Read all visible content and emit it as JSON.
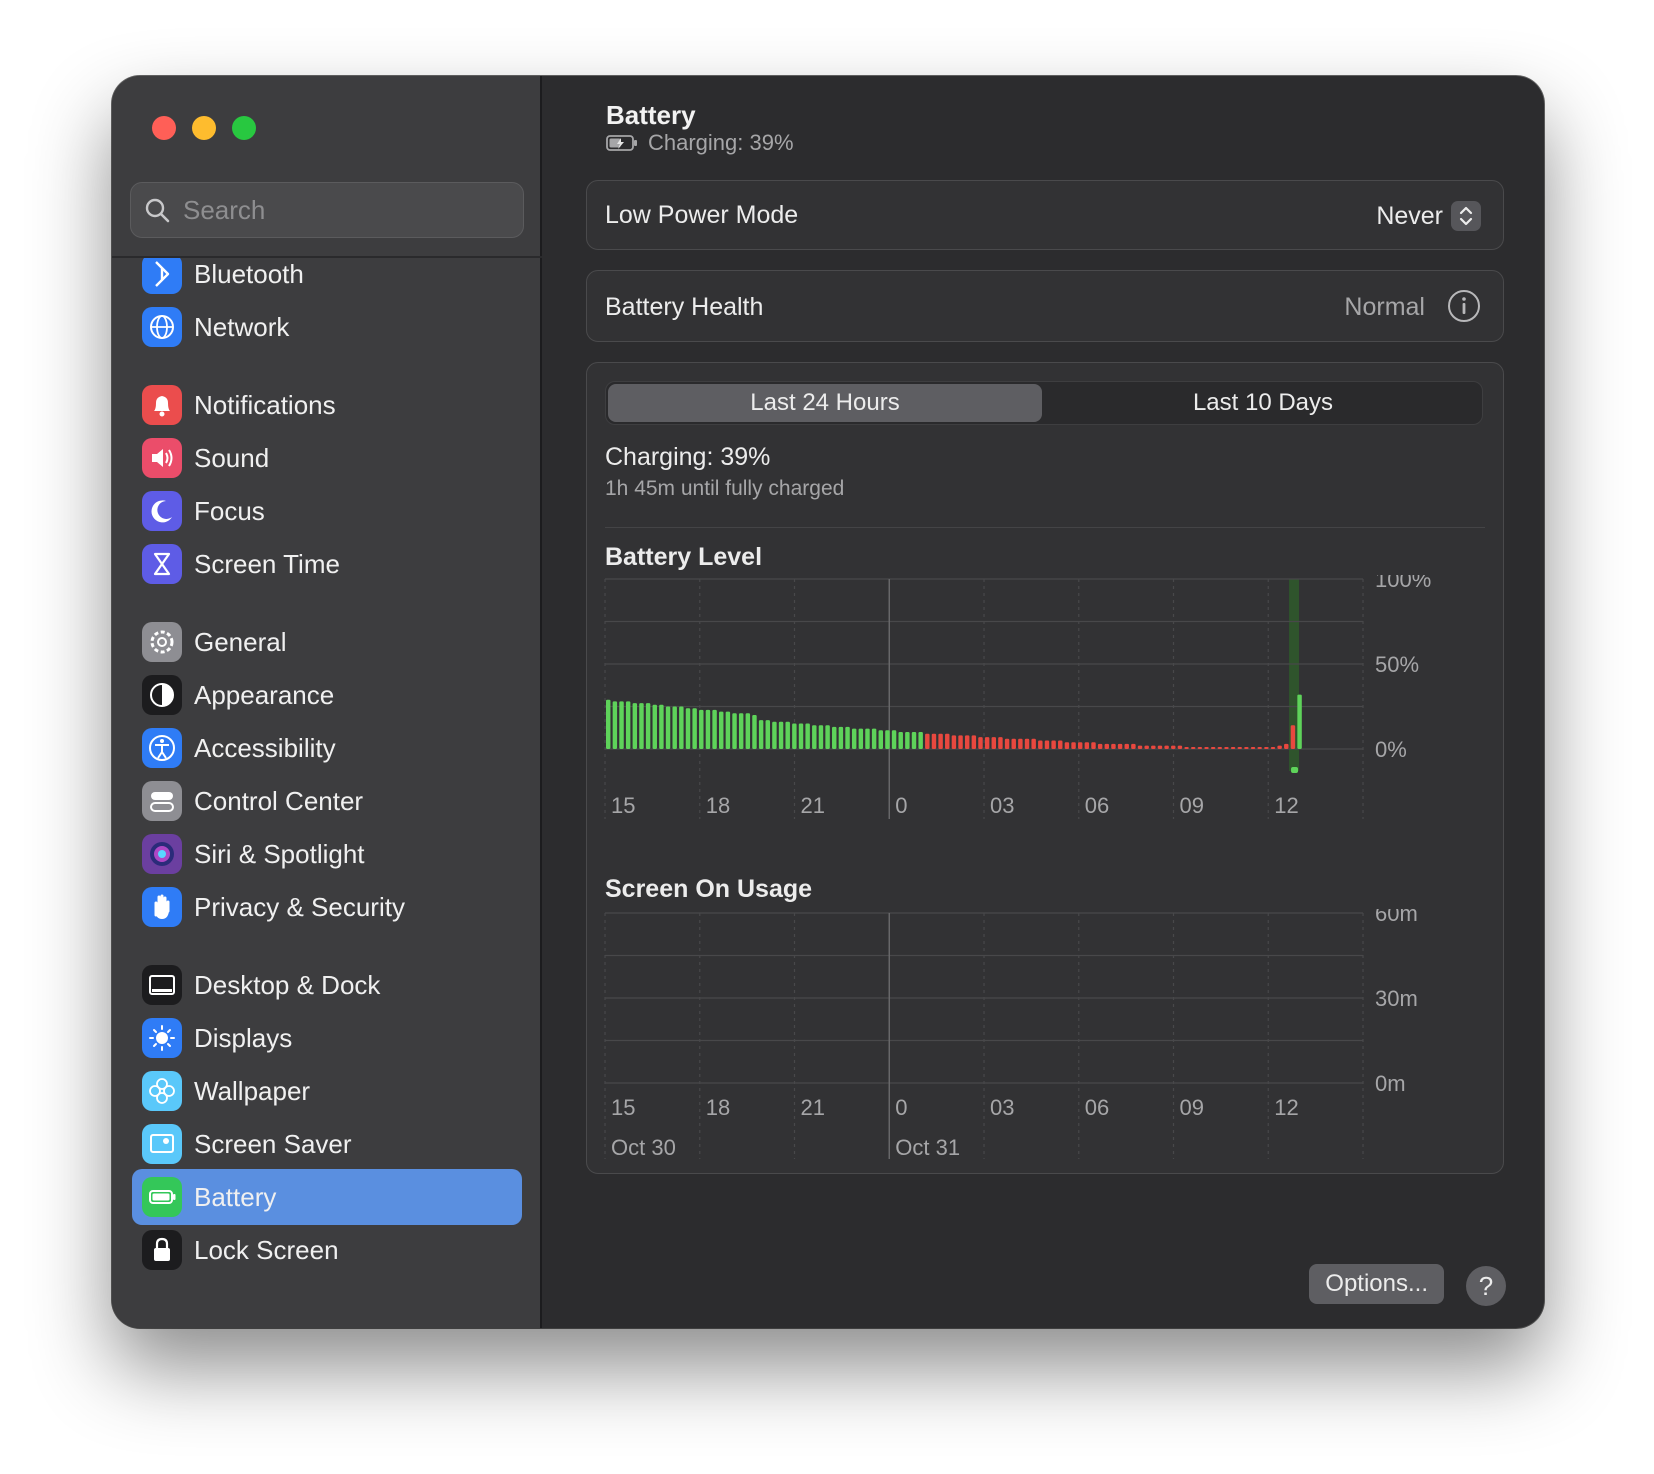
{
  "window": {
    "search_placeholder": "Search"
  },
  "sidebar": {
    "items": [
      {
        "label": "Bluetooth",
        "icon": "bluetooth-icon",
        "color": "#2f7cf6"
      },
      {
        "label": "Network",
        "icon": "globe-icon",
        "color": "#2f7cf6"
      },
      {
        "label": "Notifications",
        "icon": "bell-icon",
        "color": "#eb4d4d"
      },
      {
        "label": "Sound",
        "icon": "speaker-icon",
        "color": "#eb4d6a"
      },
      {
        "label": "Focus",
        "icon": "moon-icon",
        "color": "#5e5ce6"
      },
      {
        "label": "Screen Time",
        "icon": "hourglass-icon",
        "color": "#5e5ce6"
      },
      {
        "label": "General",
        "icon": "gear-icon",
        "color": "#8e8e93"
      },
      {
        "label": "Appearance",
        "icon": "appearance-icon",
        "color": "#1c1c1e"
      },
      {
        "label": "Accessibility",
        "icon": "accessibility-icon",
        "color": "#2f7cf6"
      },
      {
        "label": "Control Center",
        "icon": "toggles-icon",
        "color": "#8e8e93"
      },
      {
        "label": "Siri & Spotlight",
        "icon": "siri-icon",
        "color": "#6b3fa0"
      },
      {
        "label": "Privacy & Security",
        "icon": "hand-icon",
        "color": "#2f7cf6"
      },
      {
        "label": "Desktop & Dock",
        "icon": "dock-icon",
        "color": "#1c1c1e"
      },
      {
        "label": "Displays",
        "icon": "sun-icon",
        "color": "#2f7cf6"
      },
      {
        "label": "Wallpaper",
        "icon": "flower-icon",
        "color": "#5ac8fa"
      },
      {
        "label": "Screen Saver",
        "icon": "screensaver-icon",
        "color": "#5ac8fa"
      },
      {
        "label": "Battery",
        "icon": "battery-icon",
        "color": "#34c759",
        "selected": true
      },
      {
        "label": "Lock Screen",
        "icon": "lock-icon",
        "color": "#1c1c1e"
      }
    ]
  },
  "header": {
    "title": "Battery",
    "subtitle": "Charging: 39%"
  },
  "low_power": {
    "label": "Low Power Mode",
    "value": "Never"
  },
  "health": {
    "label": "Battery Health",
    "value": "Normal"
  },
  "tabs": [
    {
      "label": "Last 24 Hours",
      "active": true
    },
    {
      "label": "Last 10 Days",
      "active": false
    }
  ],
  "status": {
    "title": "Charging: 39%",
    "subtitle": "1h 45m until fully charged"
  },
  "footer": {
    "options_label": "Options...",
    "help_label": "?"
  },
  "colors": {
    "charging": "#5ed35a",
    "discharging": "#e8483f",
    "selected": "#5a8fe0"
  },
  "chart_data": [
    {
      "type": "bar",
      "title": "Battery Level",
      "y_ticks": [
        "100%",
        "50%",
        "0%"
      ],
      "ylim": [
        0,
        100
      ],
      "x_ticks": [
        "15",
        "18",
        "21",
        "0",
        "03",
        "06",
        "09",
        "12"
      ],
      "series": [
        {
          "values": [
            29,
            28,
            28,
            28,
            27,
            27,
            27,
            26,
            26,
            25,
            25,
            25,
            24,
            24,
            23,
            23,
            23,
            22,
            22,
            21,
            21,
            21,
            20,
            17,
            17,
            16,
            16,
            16,
            15,
            15,
            15,
            14,
            14,
            14,
            13,
            13,
            13,
            12,
            12,
            12,
            12,
            11,
            11,
            11,
            10,
            10,
            10,
            10,
            9,
            9,
            9,
            9,
            8,
            8,
            8,
            8,
            7,
            7,
            7,
            7,
            6,
            6,
            6,
            6,
            6,
            5,
            5,
            5,
            5,
            4,
            4,
            4,
            4,
            4,
            3,
            3,
            3,
            3,
            3,
            3,
            2,
            2,
            2,
            2,
            2,
            2,
            2,
            1,
            1,
            1,
            1,
            1,
            1,
            1,
            1,
            1,
            1,
            1,
            1,
            1,
            1,
            2,
            3,
            14,
            32
          ],
          "status": [
            "charge",
            "charge",
            "charge",
            "charge",
            "charge",
            "charge",
            "charge",
            "charge",
            "charge",
            "charge",
            "charge",
            "charge",
            "charge",
            "charge",
            "charge",
            "charge",
            "charge",
            "charge",
            "charge",
            "charge",
            "charge",
            "charge",
            "charge",
            "charge",
            "charge",
            "charge",
            "charge",
            "charge",
            "charge",
            "charge",
            "charge",
            "charge",
            "charge",
            "charge",
            "charge",
            "charge",
            "charge",
            "charge",
            "charge",
            "charge",
            "charge",
            "charge",
            "charge",
            "charge",
            "charge",
            "charge",
            "charge",
            "charge",
            "drain",
            "drain",
            "drain",
            "drain",
            "drain",
            "drain",
            "drain",
            "drain",
            "drain",
            "drain",
            "drain",
            "drain",
            "drain",
            "drain",
            "drain",
            "drain",
            "drain",
            "drain",
            "drain",
            "drain",
            "drain",
            "drain",
            "drain",
            "drain",
            "drain",
            "drain",
            "drain",
            "drain",
            "drain",
            "drain",
            "drain",
            "drain",
            "drain",
            "drain",
            "drain",
            "drain",
            "drain",
            "drain",
            "drain",
            "drain",
            "drain",
            "drain",
            "drain",
            "drain",
            "drain",
            "drain",
            "drain",
            "drain",
            "drain",
            "drain",
            "drain",
            "drain",
            "drain",
            "drain",
            "drain",
            "drain",
            "charge"
          ]
        }
      ]
    },
    {
      "type": "bar",
      "title": "Screen On Usage",
      "y_ticks": [
        "60m",
        "30m",
        "0m"
      ],
      "ylim": [
        0,
        60
      ],
      "x_ticks": [
        "15",
        "18",
        "21",
        "0",
        "03",
        "06",
        "09",
        "12"
      ],
      "date_labels": [
        "Oct 30",
        "Oct 31"
      ],
      "series": [
        {
          "values": [
            0,
            0,
            0,
            0,
            0,
            0,
            0,
            0,
            0,
            0,
            0,
            0,
            0,
            0,
            0,
            0,
            0,
            0,
            0,
            0,
            0,
            0,
            0,
            0
          ]
        }
      ]
    }
  ]
}
